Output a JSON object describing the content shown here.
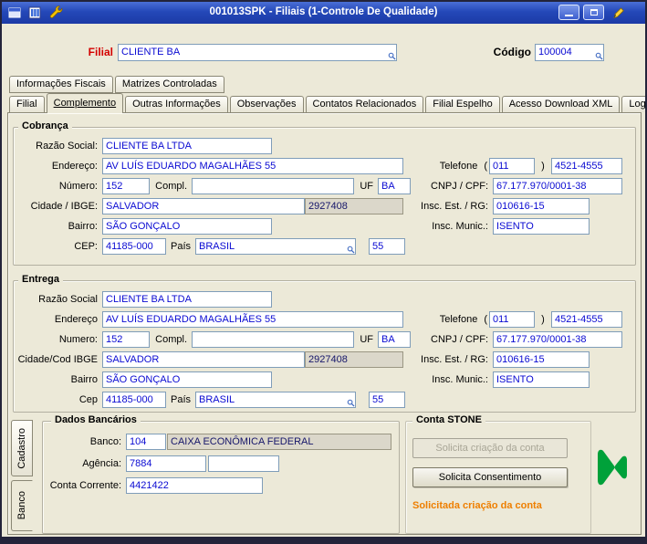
{
  "window": {
    "title": "001013SPK - Filiais (1-Controle De Qualidade)"
  },
  "header": {
    "filial_label": "Filial",
    "filial_value": "CLIENTE BA",
    "codigo_label": "Código",
    "codigo_value": "100004"
  },
  "tabs": {
    "top": [
      "Informações Fiscais",
      "Matrizes Controladas"
    ],
    "main": [
      "Filial",
      "Complemento",
      "Outras Informações",
      "Observações",
      "Contatos Relacionados",
      "Filial Espelho",
      "Acesso Download XML",
      "Log"
    ],
    "active_main": "Complemento",
    "side": [
      "Cadastro",
      "Banco"
    ],
    "active_side": "Banco"
  },
  "symbols": {
    "paren_open": "(",
    "paren_close": ")"
  },
  "cobranca": {
    "title": "Cobrança",
    "labels": {
      "razao": "Razão Social:",
      "endereco": "Endereço:",
      "numero": "Número:",
      "compl": "Compl.",
      "uf": "UF",
      "cidade": "Cidade / IBGE:",
      "bairro": "Bairro:",
      "cep": "CEP:",
      "pais": "País",
      "telefone": "Telefone",
      "cnpj": "CNPJ / CPF:",
      "ie": "Insc. Est. / RG:",
      "im": "Insc. Munic.:"
    },
    "values": {
      "razao": "CLIENTE BA LTDA",
      "endereco": "AV LUÍS EDUARDO MAGALHÃES 55",
      "numero": "152",
      "compl": "",
      "uf": "BA",
      "cidade": "SALVADOR",
      "ibge": "2927408",
      "bairro": "SÃO GONÇALO",
      "cep": "41185-000",
      "pais": "BRASIL",
      "pais_cod": "55",
      "ddd": "011",
      "fone": "4521-4555",
      "cnpj": "67.177.970/0001-38",
      "ie": "010616-15",
      "im": "ISENTO"
    }
  },
  "entrega": {
    "title": "Entrega",
    "labels": {
      "razao": "Razão Social",
      "endereco": "Endereço",
      "numero": "Numero:",
      "compl": "Compl.",
      "uf": "UF",
      "cidade": "Cidade/Cod IBGE",
      "bairro": "Bairro",
      "cep": "Cep",
      "pais": "País",
      "telefone": "Telefone",
      "cnpj": "CNPJ / CPF:",
      "ie": "Insc. Est. / RG:",
      "im": "Insc. Munic.:"
    },
    "values": {
      "razao": "CLIENTE BA LTDA",
      "endereco": "AV LUÍS EDUARDO MAGALHÃES 55",
      "numero": "152",
      "compl": "",
      "uf": "BA",
      "cidade": "SALVADOR",
      "ibge": "2927408",
      "bairro": "SÃO GONÇALO",
      "cep": "41185-000",
      "pais": "BRASIL",
      "pais_cod": "55",
      "ddd": "011",
      "fone": "4521-4555",
      "cnpj": "67.177.970/0001-38",
      "ie": "010616-15",
      "im": "ISENTO"
    }
  },
  "dados_bancarios": {
    "title": "Dados Bancários",
    "labels": {
      "banco": "Banco:",
      "agencia": "Agência:",
      "conta": "Conta Corrente:"
    },
    "values": {
      "banco_cod": "104",
      "banco_nome": "CAIXA ECONÔMICA FEDERAL",
      "agencia": "7884",
      "agencia_dv": "",
      "conta": "4421422"
    }
  },
  "conta_stone": {
    "title": "Conta STONE",
    "btn_criacao": "Solicita criação da conta",
    "btn_consentimento": "Solicita Consentimento",
    "status": "Solicitada criação da conta"
  },
  "colors": {
    "titlebar_blue": "#2448b8",
    "field_text_blue": "#0a0ad2",
    "filial_label_red": "#d40000",
    "status_orange": "#ee7f01",
    "stone_green": "#00a13a",
    "window_bg": "#ece9d8"
  }
}
